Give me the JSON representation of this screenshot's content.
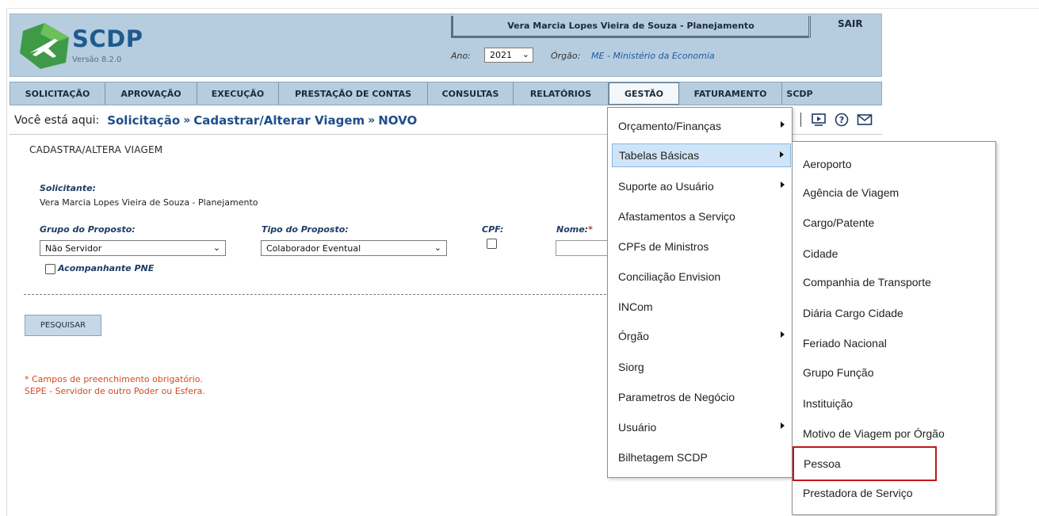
{
  "header": {
    "app_name": "SCDP",
    "version": "Versão 8.2.0",
    "user": "Vera Marcia Lopes Vieira de Souza - Planejamento",
    "logout": "SAIR",
    "ano_label": "Ano:",
    "ano_value": "2021",
    "orgao_label": "Órgão:",
    "orgao_value": "ME - Ministério da Economia"
  },
  "menu": [
    {
      "label": "SOLICITAÇÃO"
    },
    {
      "label": "APROVAÇÃO"
    },
    {
      "label": "EXECUÇÃO"
    },
    {
      "label": "PRESTAÇÃO DE CONTAS"
    },
    {
      "label": "CONSULTAS"
    },
    {
      "label": "RELATÓRIOS"
    },
    {
      "label": "GESTÃO"
    },
    {
      "label": "FATURAMENTO"
    },
    {
      "label": "SCDP"
    }
  ],
  "breadcrumb": {
    "prefix": "Você está aqui:",
    "items": [
      "Solicitação",
      "Cadastrar/Alterar Viagem",
      "NOVO"
    ]
  },
  "toolbar": {
    "icons": [
      "presentation-icon",
      "help-icon",
      "mail-icon"
    ]
  },
  "form": {
    "title": "CADASTRA/ALTERA VIAGEM",
    "solicitante_label": "Solicitante:",
    "solicitante_value": "Vera Marcia Lopes Vieira de Souza - Planejamento",
    "grupo_label": "Grupo do Proposto:",
    "grupo_value": "Não Servidor",
    "tipo_label": "Tipo do Proposto:",
    "tipo_value": "Colaborador Eventual",
    "cpf_label": "CPF:",
    "nome_label": "Nome:",
    "nome_required": "*",
    "acompanhante_label": "Acompanhante PNE",
    "search_button": "PESQUISAR",
    "note_required": "* Campos de preenchimento obrigatório.",
    "note_sepe": "SEPE - Servidor de outro Poder ou Esfera."
  },
  "gestao_menu": [
    {
      "label": "Orçamento/Finanças",
      "submenu": true
    },
    {
      "label": "Tabelas Básicas",
      "submenu": true,
      "highlighted": true
    },
    {
      "label": "Suporte ao Usuário",
      "submenu": true
    },
    {
      "label": "Afastamentos a Serviço",
      "submenu": false
    },
    {
      "label": "CPFs de Ministros",
      "submenu": false
    },
    {
      "label": "Conciliação Envision",
      "submenu": false
    },
    {
      "label": "INCom",
      "submenu": false
    },
    {
      "label": "Órgão",
      "submenu": true
    },
    {
      "label": "Siorg",
      "submenu": false
    },
    {
      "label": "Parametros de Negócio",
      "submenu": false
    },
    {
      "label": "Usuário",
      "submenu": true
    },
    {
      "label": "Bilhetagem SCDP",
      "submenu": false
    }
  ],
  "tabelas_submenu": [
    {
      "label": "Aeroporto"
    },
    {
      "label": "Agência de Viagem"
    },
    {
      "label": "Cargo/Patente"
    },
    {
      "label": "Cidade"
    },
    {
      "label": "Companhia de Transporte"
    },
    {
      "label": "Diária Cargo Cidade"
    },
    {
      "label": "Feriado Nacional"
    },
    {
      "label": "Grupo Função"
    },
    {
      "label": "Instituição"
    },
    {
      "label": "Motivo de Viagem por Órgão"
    },
    {
      "label": "Pessoa",
      "marked": true
    },
    {
      "label": "Prestadora de Serviço"
    }
  ],
  "colors": {
    "header_bg": "#b5cddf",
    "menu_bg": "#b5cddf",
    "link_blue": "#1f4e8a",
    "label_blue": "#1f3c66",
    "note_red": "#d24b1f",
    "highlight_box": "#c0171c",
    "logo_green": "#3f9a48",
    "logo_blue": "#1f5a8f"
  }
}
